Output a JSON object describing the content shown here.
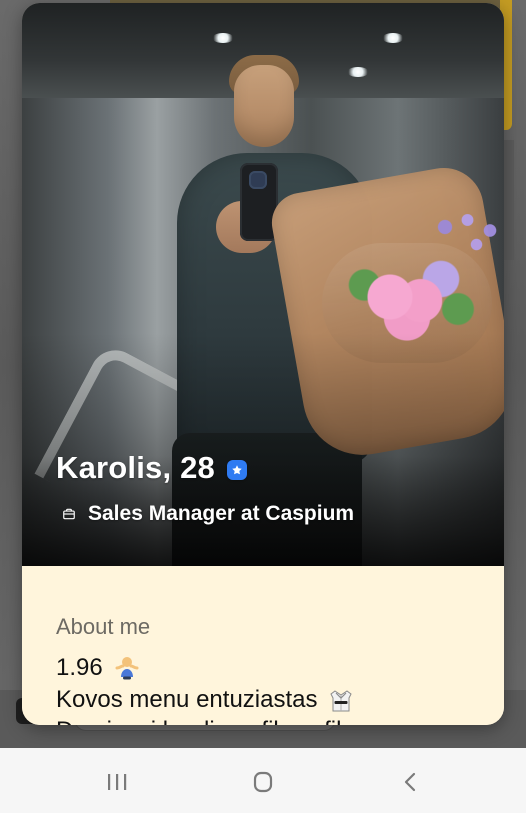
{
  "profile": {
    "name_age": "Karolis, 28",
    "job": "Sales Manager at Caspium"
  },
  "about": {
    "heading": "About me",
    "line1": "1.96",
    "line2": "Kovos menu entuziastas",
    "line3": "Domiuosi kardiom, fiksu, fiks"
  },
  "icons": {
    "verified": "verified-badge-icon",
    "job": "briefcase-icon",
    "shrug": "person-shrugging-icon",
    "gi": "martial-arts-uniform-icon",
    "recents": "recents-icon",
    "home": "home-icon",
    "back": "back-icon"
  },
  "colors": {
    "verified_blue": "#2f7bf2",
    "about_bg": "#fff5dc",
    "nav_bg": "#f6f6f6",
    "heading_gray": "#6d6a63",
    "text_black": "#111111"
  }
}
